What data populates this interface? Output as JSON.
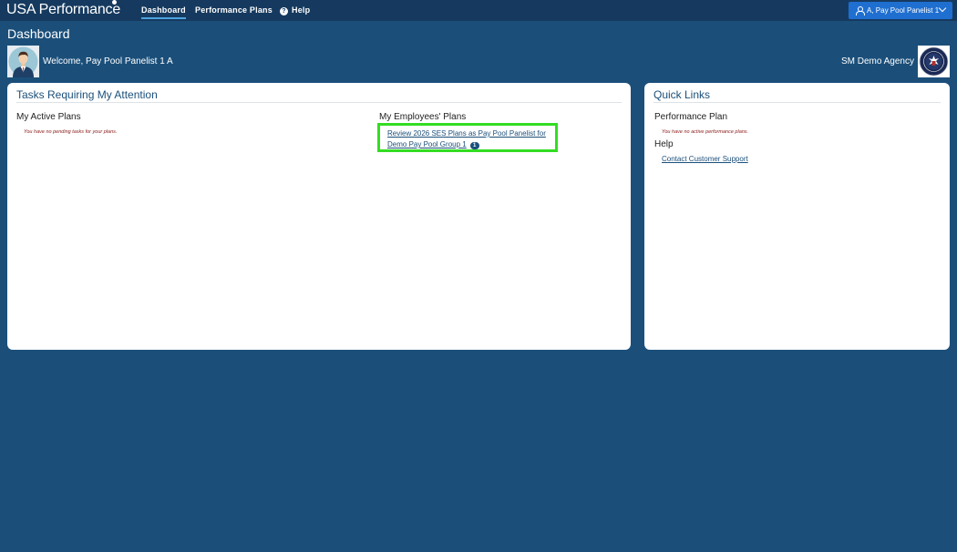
{
  "header": {
    "brand": "USA Performance",
    "nav": [
      {
        "label": "Dashboard",
        "active": true
      },
      {
        "label": "Performance Plans",
        "active": false
      },
      {
        "label": "Help",
        "active": false
      }
    ],
    "user_menu_label": "A, Pay Pool Panelist 1"
  },
  "page": {
    "title": "Dashboard",
    "welcome": "Welcome, Pay Pool Panelist 1 A",
    "agency": "SM Demo Agency"
  },
  "tasks_card": {
    "title": "Tasks Requiring My Attention",
    "active_plans": {
      "heading": "My Active Plans",
      "empty_note": "You have no pending tasks for your plans."
    },
    "employee_plans": {
      "heading": "My Employees' Plans",
      "task_link": "Review 2026 SES Plans as Pay Pool Panelist for Demo Pay Pool Group 1",
      "task_count": "1"
    }
  },
  "links_card": {
    "title": "Quick Links",
    "performance_plan": {
      "heading": "Performance Plan",
      "empty_note": "You have no active performance plans."
    },
    "help": {
      "heading": "Help",
      "link": "Contact Customer Support"
    }
  },
  "colors": {
    "background": "#1b4f7a",
    "topbar": "#163a5f",
    "user_menu": "#1f6fd1",
    "highlight": "#33dd22",
    "empty_note": "#8a1a1a"
  }
}
